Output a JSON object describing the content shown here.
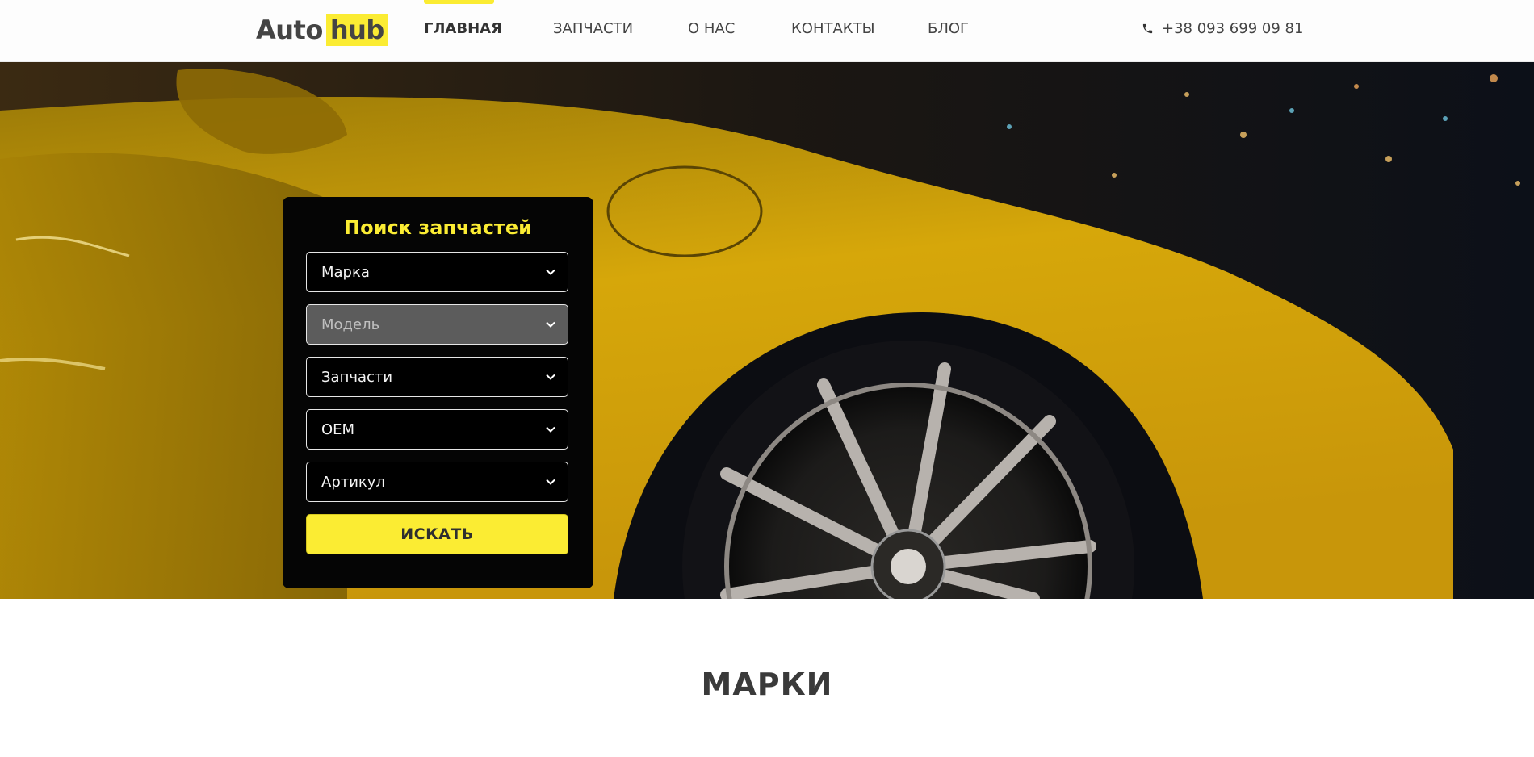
{
  "logo": {
    "auto": "Auto",
    "hub": "hub"
  },
  "nav": {
    "items": [
      {
        "label": "ГЛАВНАЯ",
        "active": true
      },
      {
        "label": "ЗАПЧАСТИ",
        "active": false
      },
      {
        "label": "О НАС",
        "active": false
      },
      {
        "label": "КОНТАКТЫ",
        "active": false
      },
      {
        "label": "БЛОГ",
        "active": false
      }
    ]
  },
  "header": {
    "phone": "+38 093 699 09 81",
    "phone_icon": "phone-icon"
  },
  "search": {
    "title": "Поиск запчастей",
    "fields": [
      {
        "label": "Марка",
        "disabled": false
      },
      {
        "label": "Модель",
        "disabled": true
      },
      {
        "label": "Запчасти",
        "disabled": false
      },
      {
        "label": "OEM",
        "disabled": false
      },
      {
        "label": "Артикул",
        "disabled": false
      }
    ],
    "button_label": "ИСКАТЬ"
  },
  "brands": {
    "title": "МАРКИ"
  },
  "colors": {
    "accent": "#fbec33",
    "panel": "#050505",
    "text": "#444444"
  }
}
